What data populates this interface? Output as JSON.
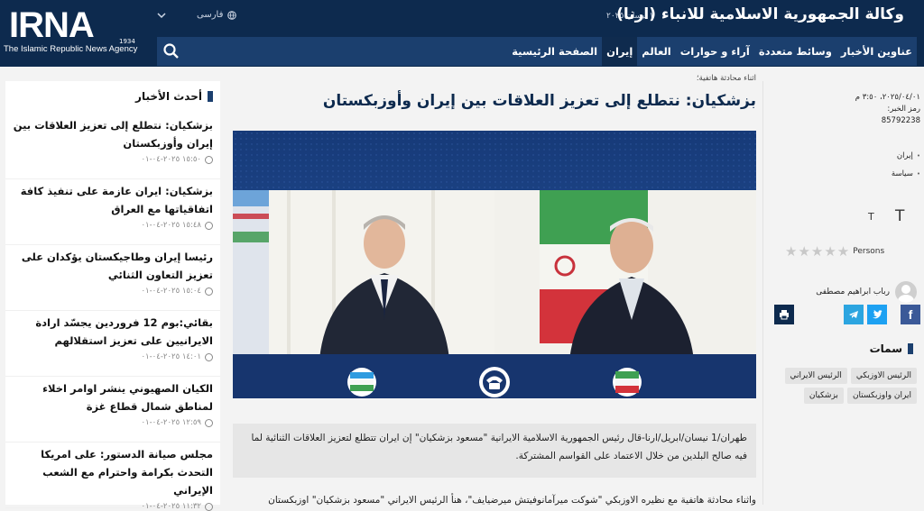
{
  "header": {
    "logo_main": "IRNA",
    "logo_sub": "The Islamic Republic News Agency",
    "logo_year": "1934",
    "agency_title": "وكالة الجمهورية الاسلامية للانباء (ارنا)",
    "date": "١ نيسان ٢٠٢٥",
    "language": "فارسی"
  },
  "nav": {
    "items": [
      {
        "label": "الصفحة الرئيسية",
        "active": false
      },
      {
        "label": "إيران",
        "active": true
      },
      {
        "label": "العالم",
        "active": false
      },
      {
        "label": "آراء و حوارات",
        "active": false
      },
      {
        "label": "وسائط متعددة",
        "active": false
      },
      {
        "label": "عناوين الأخبار",
        "active": false
      }
    ]
  },
  "latest": {
    "heading": "أحدث الأخبار",
    "items": [
      {
        "title": "بزشكيان: نتطلع إلى تعزيز العلاقات بين إيران وأوزبكستان",
        "time": "١٥:٥٠ ٢٠٢٥-٠٤-٠١"
      },
      {
        "title": "بزشكيان: ايران عازمة على تنفيذ كافة اتفاقياتها مع العراق",
        "time": "١٥:٤٨ ٢٠٢٥-٠٤-٠١"
      },
      {
        "title": "رئيسا إيران وطاجيكستان يؤكدان على تعزيز التعاون الثنائي",
        "time": "١٥:٠٤ ٢٠٢٥-٠٤-٠١"
      },
      {
        "title": "بقائي:بوم 12 فروردين يجسّد ارادة الايرانيين على تعزيز استقلالهم",
        "time": "١٤:٠١ ٢٠٢٥-٠٤-٠١"
      },
      {
        "title": "الكيان الصهيوني ينشر اوامر اخلاء لمناطق شمال قطاع غزة",
        "time": "١٢:٥٩ ٢٠٢٥-٠٤-٠١"
      },
      {
        "title": "مجلس صيانة الدستور: على امريكا التحدث بكرامة واحترام مع الشعب الإيراني",
        "time": "١١:٣٢ ٢٠٢٥-٠٤-٠١"
      }
    ]
  },
  "article": {
    "kicker": "اثناء محادثة هاتفية؛",
    "title": "بزشكيان: نتطلع إلى تعزيز العلاقات بين إيران وأوزبكستان",
    "caption": "طهران/1 نيسان/ابريل/ارنا-قال رئيس الجمهورية الاسلامية الايرانية \"مسعود بزشكيان\" إن ايران تتطلع لتعزيز العلاقات الثنائية لما فيه صالح البلدين من خلال الاعتماد على القواسم المشتركة.",
    "body": "واثناء محادثة هاتفية مع نظيره الاوزبكي \"شوكت ميرآمانوفيتش ميرضيايف\"، هنأ الرئيس الايراني \"مسعود بزشكيان\" اوزبكستان"
  },
  "sidebar": {
    "datetime": "٢٠٢٥/٠٤/٠١، ٣:٥٠ م",
    "code_label": "رمز الخبر:",
    "code_value": "85792238",
    "tags": [
      "إيران",
      "سياسة"
    ],
    "font_small": "T",
    "font_large": "T",
    "rating_label": "Persons",
    "author": "رباب ابراهيم مصطفى",
    "tags_heading": "سمات",
    "tag_chips": [
      "الرئيس الاوزبكي",
      "الرئيس الايراني",
      "ايران واوزبكستان",
      "بزشكيان"
    ],
    "share_colors": {
      "facebook": "#3b5998",
      "twitter": "#1da1f2",
      "telegram": "#2ca5e0",
      "print": "#0d2a4e"
    }
  }
}
